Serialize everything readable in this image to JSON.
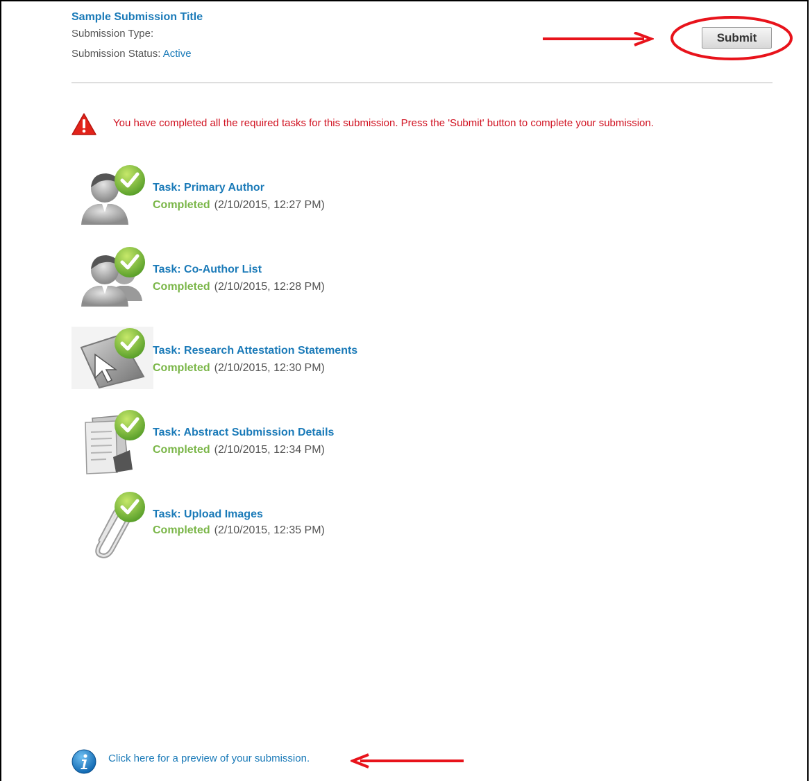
{
  "submission": {
    "title": "Sample Submission Title",
    "type_label": "Submission Type:",
    "type_value": "",
    "status_label": "Submission Status:",
    "status_value": "Active"
  },
  "submit_button": {
    "label": "Submit"
  },
  "notice": {
    "icon": "warning-triangle-icon",
    "message": "You have completed all the required tasks for this submission. Press the 'Submit' button to complete your submission."
  },
  "tasks": [
    {
      "name": "Task: Primary Author",
      "status": "Completed",
      "timestamp": "(2/10/2015, 12:27 PM)",
      "icon": "person-icon"
    },
    {
      "name": "Task: Co-Author List",
      "status": "Completed",
      "timestamp": "(2/10/2015, 12:28 PM)",
      "icon": "people-icon"
    },
    {
      "name": "Task: Research Attestation Statements",
      "status": "Completed",
      "timestamp": "(2/10/2015, 12:30 PM)",
      "icon": "cursor-arrow-icon"
    },
    {
      "name": "Task: Abstract Submission Details",
      "status": "Completed",
      "timestamp": "(2/10/2015, 12:34 PM)",
      "icon": "documents-icon"
    },
    {
      "name": "Task: Upload Images",
      "status": "Completed",
      "timestamp": "(2/10/2015, 12:35 PM)",
      "icon": "paperclip-icon"
    }
  ],
  "preview": {
    "icon": "info-icon",
    "link_text": "Click here for a preview of your submission."
  },
  "colors": {
    "link": "#1a7ab8",
    "alert": "#d0101f",
    "complete": "#7ab648",
    "annotation": "#e8131b"
  }
}
